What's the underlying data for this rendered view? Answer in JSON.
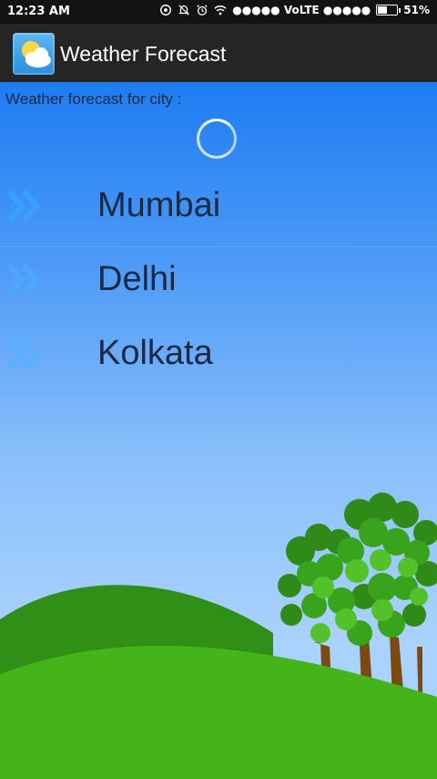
{
  "status_bar": {
    "time": "12:23 AM",
    "network": "●●●●● VoLTE ●●●●●",
    "battery_text": "51%",
    "battery_level": 0.51,
    "icons": [
      "sync-icon",
      "bell-muted-icon",
      "alarm-icon",
      "wifi-icon"
    ]
  },
  "app_bar": {
    "title": "Weather Forecast",
    "icon": "weather-cloud-icon"
  },
  "content": {
    "subtitle": "Weather forecast for city :",
    "cities": [
      "Mumbai",
      "Delhi",
      "Kolkata"
    ],
    "colors": {
      "accent": "#1e7cf2",
      "chevron": "#3aa0ff",
      "text": "#1a2a45"
    }
  }
}
